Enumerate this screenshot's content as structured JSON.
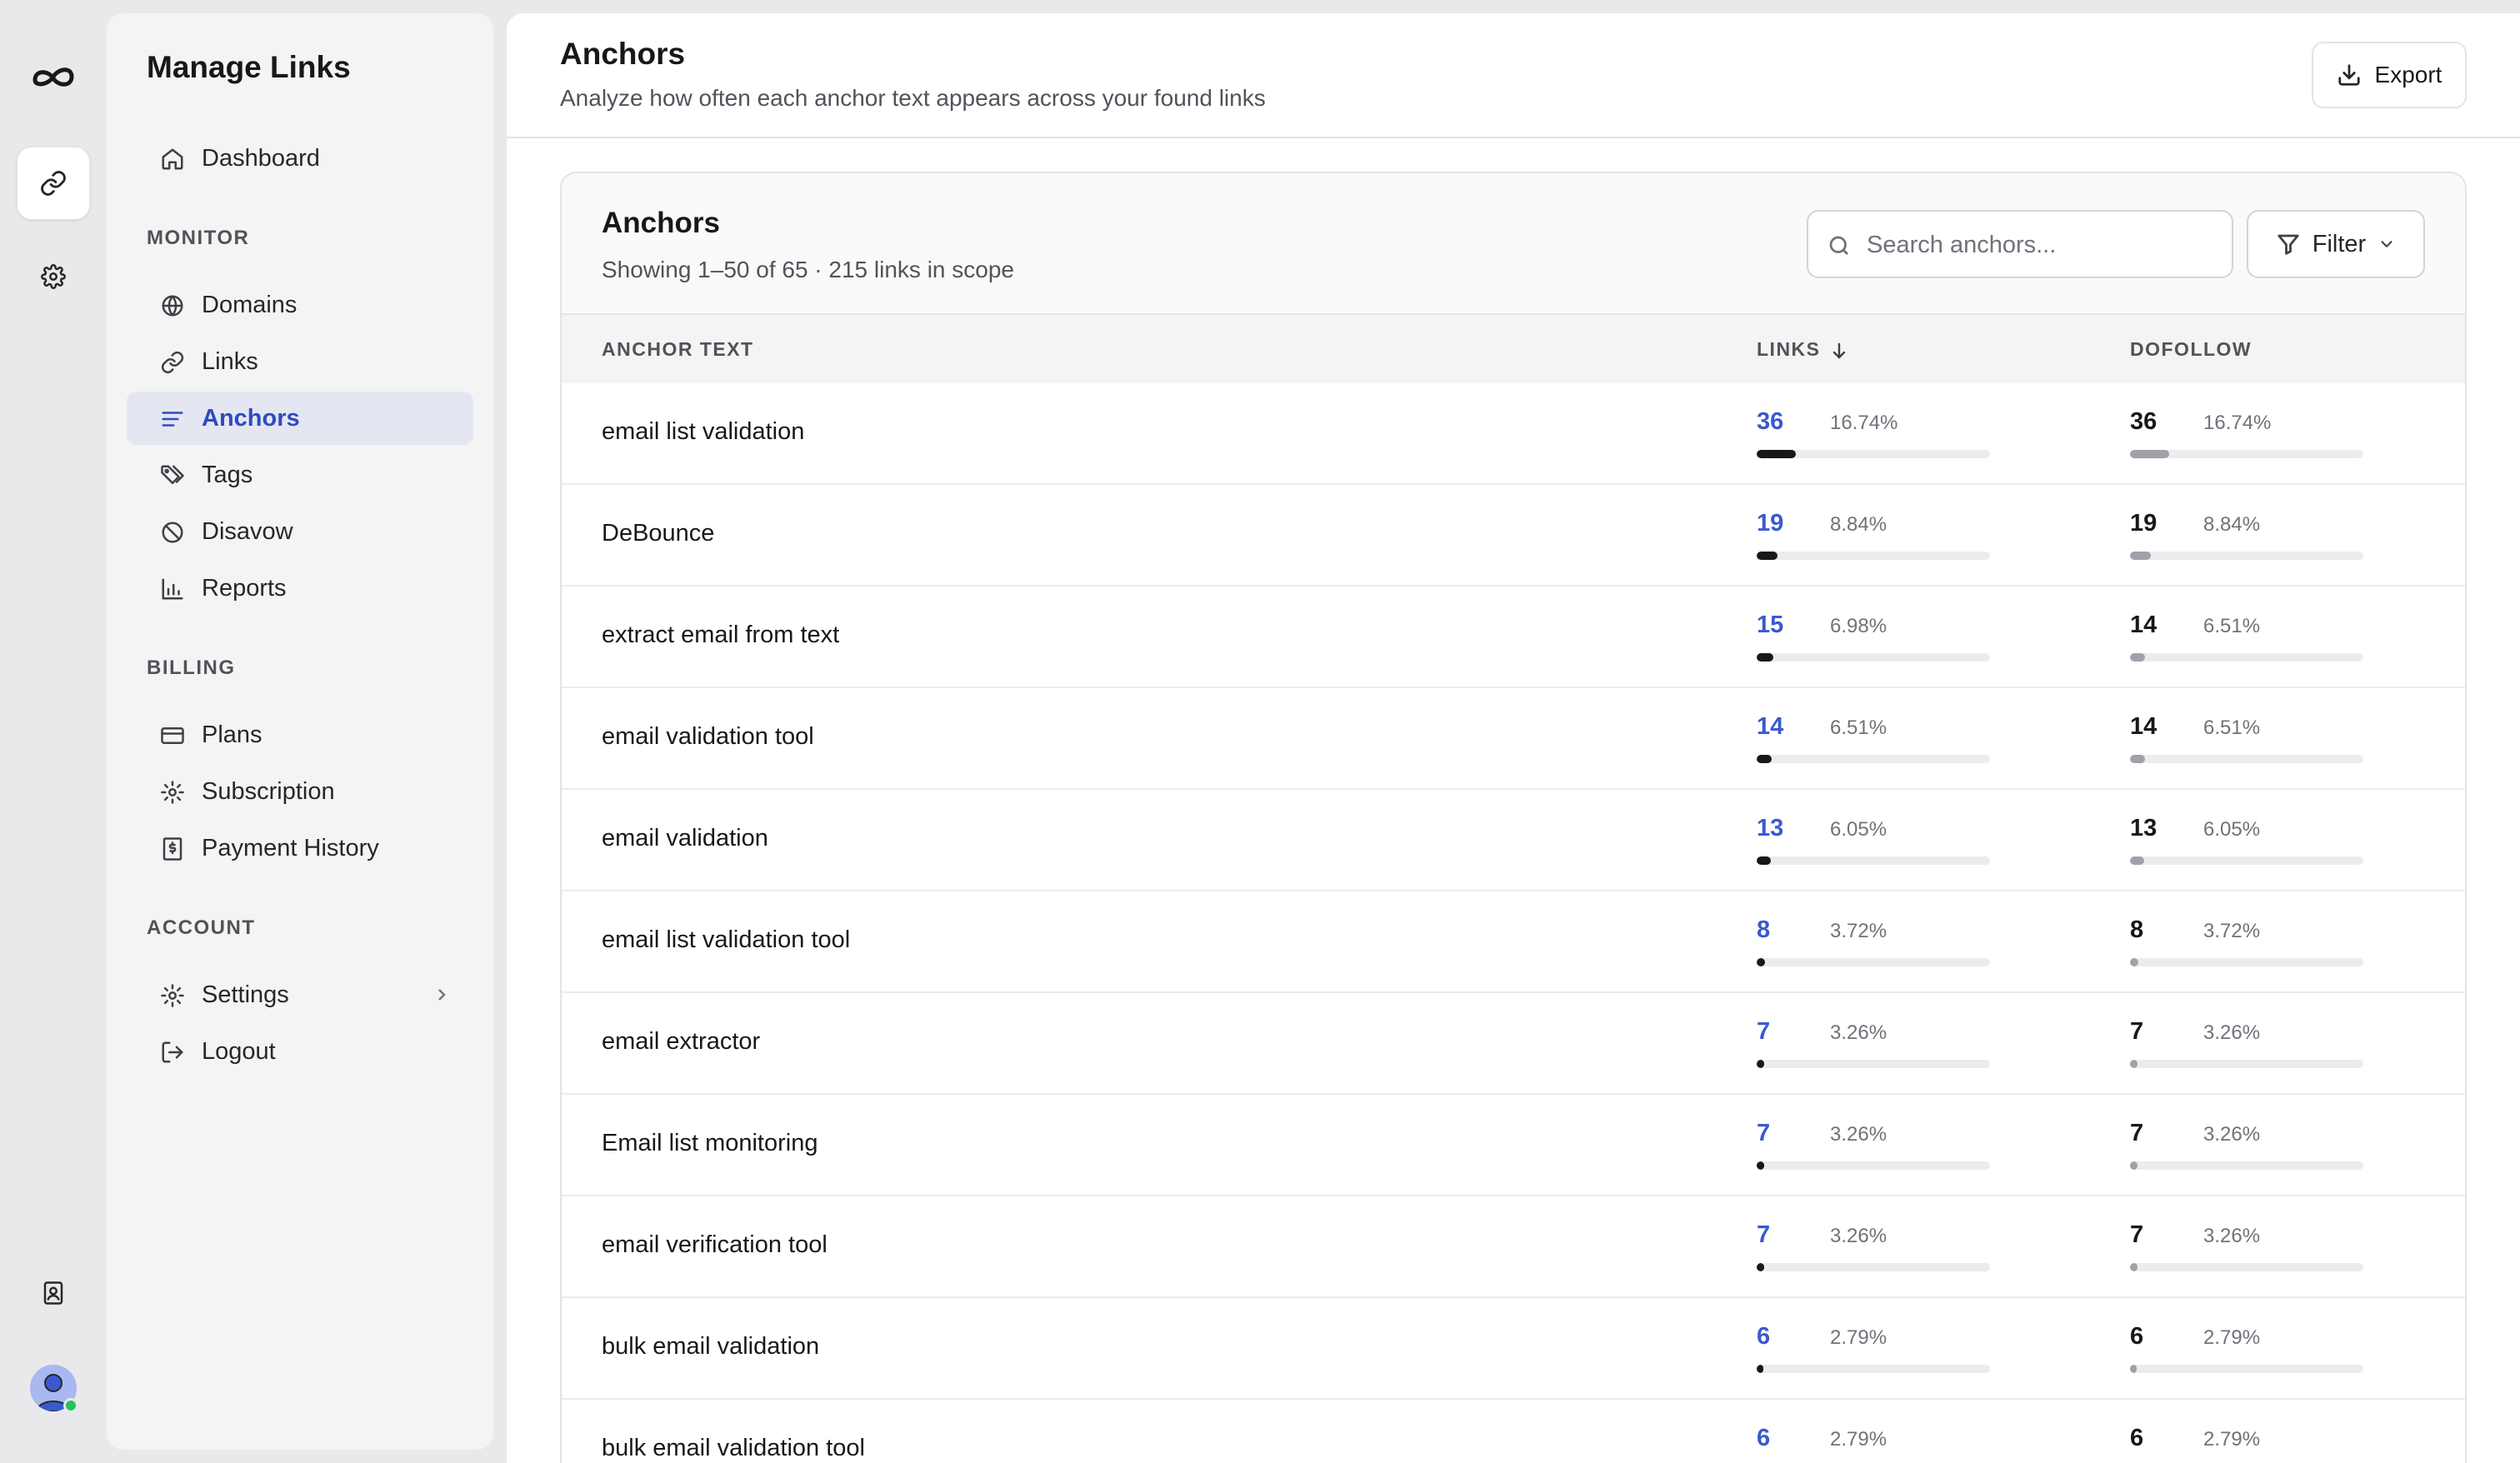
{
  "app": {
    "brand": "Manage Links"
  },
  "sidebar": {
    "top_items": [
      {
        "label": "Dashboard",
        "icon": "home-icon"
      }
    ],
    "sections": {
      "monitor": "MONITOR",
      "billing": "BILLING",
      "account": "ACCOUNT"
    },
    "monitor_items": [
      {
        "label": "Domains",
        "icon": "globe-icon"
      },
      {
        "label": "Links",
        "icon": "link-icon"
      },
      {
        "label": "Anchors",
        "icon": "lines-icon",
        "active": true
      },
      {
        "label": "Tags",
        "icon": "tags-icon"
      },
      {
        "label": "Disavow",
        "icon": "ban-icon"
      },
      {
        "label": "Reports",
        "icon": "bar-chart-icon"
      }
    ],
    "billing_items": [
      {
        "label": "Plans",
        "icon": "credit-card-icon"
      },
      {
        "label": "Subscription",
        "icon": "gear-icon"
      },
      {
        "label": "Payment History",
        "icon": "receipt-icon"
      }
    ],
    "account_items": [
      {
        "label": "Settings",
        "icon": "gear-icon"
      },
      {
        "label": "Logout",
        "icon": "logout-icon"
      }
    ]
  },
  "header": {
    "title": "Anchors",
    "subtitle": "Analyze how often each anchor text appears across your found links",
    "export_label": "Export"
  },
  "card": {
    "title": "Anchors",
    "subtitle": "Showing 1–50 of 65 · 215 links in scope",
    "search_placeholder": "Search anchors...",
    "filter_label": "Filter"
  },
  "table": {
    "columns": {
      "anchor": "ANCHOR TEXT",
      "links": "LINKS",
      "dofollow": "DOFOLLOW"
    },
    "rows": [
      {
        "anchor": "email list validation",
        "links": "36",
        "links_pct": "16.74%",
        "dofollow": "36",
        "dofollow_pct": "16.74%"
      },
      {
        "anchor": "DeBounce",
        "links": "19",
        "links_pct": "8.84%",
        "dofollow": "19",
        "dofollow_pct": "8.84%"
      },
      {
        "anchor": "extract email from text",
        "links": "15",
        "links_pct": "6.98%",
        "dofollow": "14",
        "dofollow_pct": "6.51%"
      },
      {
        "anchor": "email validation tool",
        "links": "14",
        "links_pct": "6.51%",
        "dofollow": "14",
        "dofollow_pct": "6.51%"
      },
      {
        "anchor": "email validation",
        "links": "13",
        "links_pct": "6.05%",
        "dofollow": "13",
        "dofollow_pct": "6.05%"
      },
      {
        "anchor": "email list validation tool",
        "links": "8",
        "links_pct": "3.72%",
        "dofollow": "8",
        "dofollow_pct": "3.72%"
      },
      {
        "anchor": "email extractor",
        "links": "7",
        "links_pct": "3.26%",
        "dofollow": "7",
        "dofollow_pct": "3.26%"
      },
      {
        "anchor": "Email list monitoring",
        "links": "7",
        "links_pct": "3.26%",
        "dofollow": "7",
        "dofollow_pct": "3.26%"
      },
      {
        "anchor": "email verification tool",
        "links": "7",
        "links_pct": "3.26%",
        "dofollow": "7",
        "dofollow_pct": "3.26%"
      },
      {
        "anchor": "bulk email validation",
        "links": "6",
        "links_pct": "2.79%",
        "dofollow": "6",
        "dofollow_pct": "2.79%"
      },
      {
        "anchor": "bulk email validation tool",
        "links": "6",
        "links_pct": "2.79%",
        "dofollow": "6",
        "dofollow_pct": "2.79%"
      }
    ]
  },
  "colors": {
    "accent": "#2f4bc2",
    "link_number": "#3b59cf",
    "bar_links": "#18181b",
    "bar_dofollow": "#a1a1aa",
    "status_online": "#22c55e"
  }
}
